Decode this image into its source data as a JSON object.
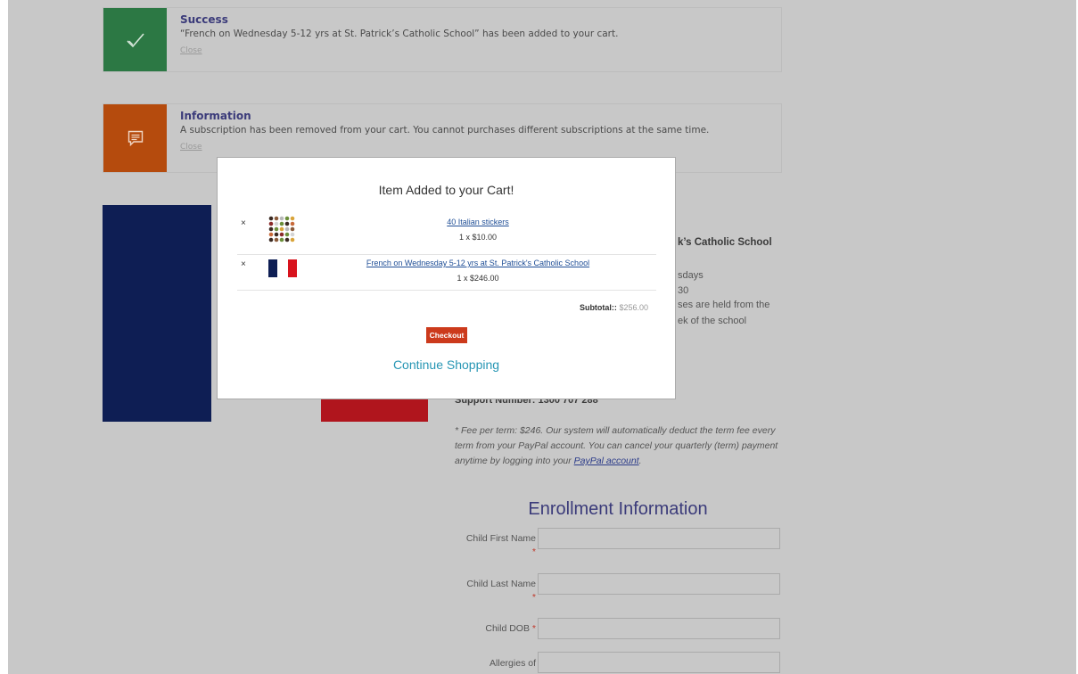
{
  "notices": {
    "success": {
      "title": "Success",
      "text": "“French on Wednesday 5-12 yrs at St. Patrick’s Catholic School” has been added to your cart.",
      "close": "Close",
      "icon": "checkmark-icon",
      "color": "#2c7844"
    },
    "info": {
      "title": "Information",
      "text": "A subscription has been removed from your cart. You cannot purchases different subscriptions at the same time.",
      "close": "Close",
      "icon": "speech-bubble-icon",
      "color": "#b54b0d"
    }
  },
  "background": {
    "school": "k’s Catholic School",
    "days": "sdays",
    "time": "30",
    "held": "ses are held from the",
    "week": "ek of the school",
    "support": "Support Number: 1300 707 288",
    "fee_text": "* Fee per term: $246. Our system will automatically deduct the term fee every term from your PayPal account. You can cancel your quarterly (term) payment anytime by logging into your",
    "fee_link": "PayPal account",
    "fee_end": "."
  },
  "enrollment": {
    "title": "Enrollment Information",
    "fields": [
      {
        "label": "Child First Name",
        "required": "*"
      },
      {
        "label": "Child Last Name",
        "required": "*"
      },
      {
        "label": "Child DOB",
        "required": "*"
      },
      {
        "label": "Allergies of",
        "required": ""
      }
    ]
  },
  "modal": {
    "title": "Item Added to your Cart!",
    "items": [
      {
        "remove": "×",
        "name": "40 Italian stickers",
        "qty": "1 x $10.00",
        "thumb": "stickers-thumbnail"
      },
      {
        "remove": "×",
        "name": "French on Wednesday 5-12 yrs at St. Patrick's Catholic School",
        "qty": "1 x $246.00",
        "thumb": "french-flag-thumbnail"
      }
    ],
    "subtotal_label": "Subtotal::",
    "subtotal_value": "$256.00",
    "checkout": "Checkout",
    "continue": "Continue Shopping"
  },
  "colors": {
    "overlay": "#c8c8c8",
    "checkout": "#cc3a1c",
    "link": "#2796b4",
    "heading": "#3b3b7a"
  }
}
